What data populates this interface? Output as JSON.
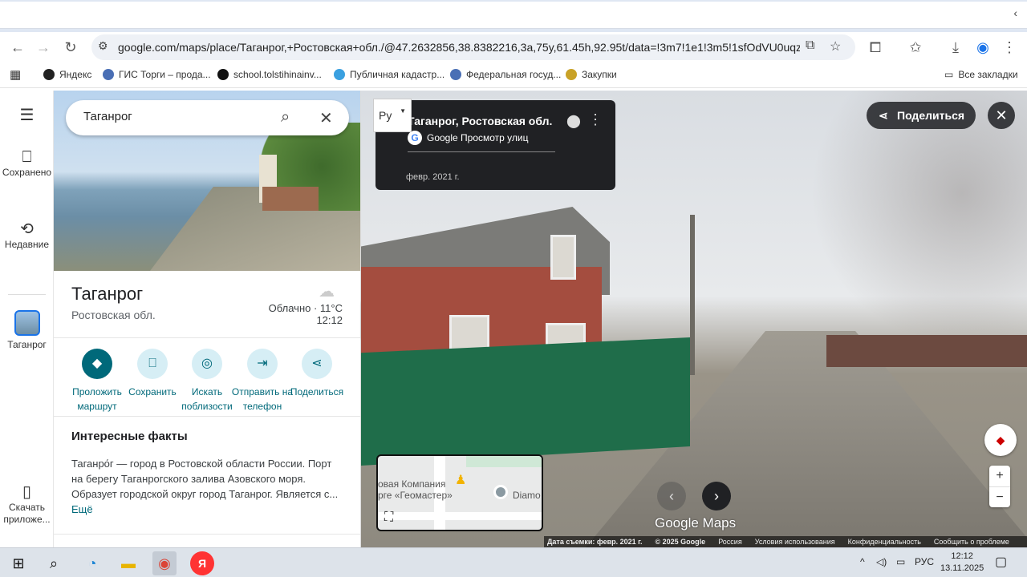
{
  "browser": {
    "url": "google.com/maps/place/Таганрог,+Ростовская+обл./@47.2632856,38.8382216,3a,75y,61.45h,92.95t/data=!3m7!1e1!3m5!1sfOdVU0uqzcBKBZ3...",
    "bookmarks": [
      "Яндекс",
      "ГИС Торги – прода...",
      "school.tolstihinainv...",
      "Публичная кадастр...",
      "Федеральная госуд...",
      "Закупки"
    ],
    "all_bookmarks": "Все закладки"
  },
  "rail": {
    "saved": "Сохранено",
    "recent": "Недавние",
    "place": "Таганрог",
    "download": "Скачать приложе..."
  },
  "search": {
    "value": "Таганрог"
  },
  "place": {
    "title": "Таганрог",
    "subtitle": "Ростовская обл.",
    "weather": "Облачно · 11°C",
    "time": "12:12"
  },
  "actions": [
    "Проложить маршрут",
    "Сохранить",
    "Искать поблизости",
    "Отправить на телефон",
    "Поделиться"
  ],
  "facts": {
    "title": "Интересные факты",
    "text": "Таганро́г — город в Ростовской области России. Порт на берегу Таганрогского залива Азовского моря. Образует городской округ город Таганрог. Является с...",
    "more": "Ещё"
  },
  "streetview": {
    "title": "Таганрог, Ростовская обл.",
    "source": "Google Просмотр улиц",
    "date": "февр. 2021 г.",
    "lang": "Ру",
    "share": "Поделиться",
    "minimap_text1": "овая Компания",
    "minimap_text2": "рге «Геомастер»",
    "minimap_text3": "Diamo",
    "brand": "Google Maps",
    "footer": [
      "Дата съемки: февр. 2021 г.",
      "© 2025 Google",
      "Россия",
      "Условия использования",
      "Конфиденциальность",
      "Сообщить о проблеме"
    ]
  },
  "taskbar": {
    "lang": "РУС",
    "time": "12:12",
    "date": "13.11.2025"
  }
}
